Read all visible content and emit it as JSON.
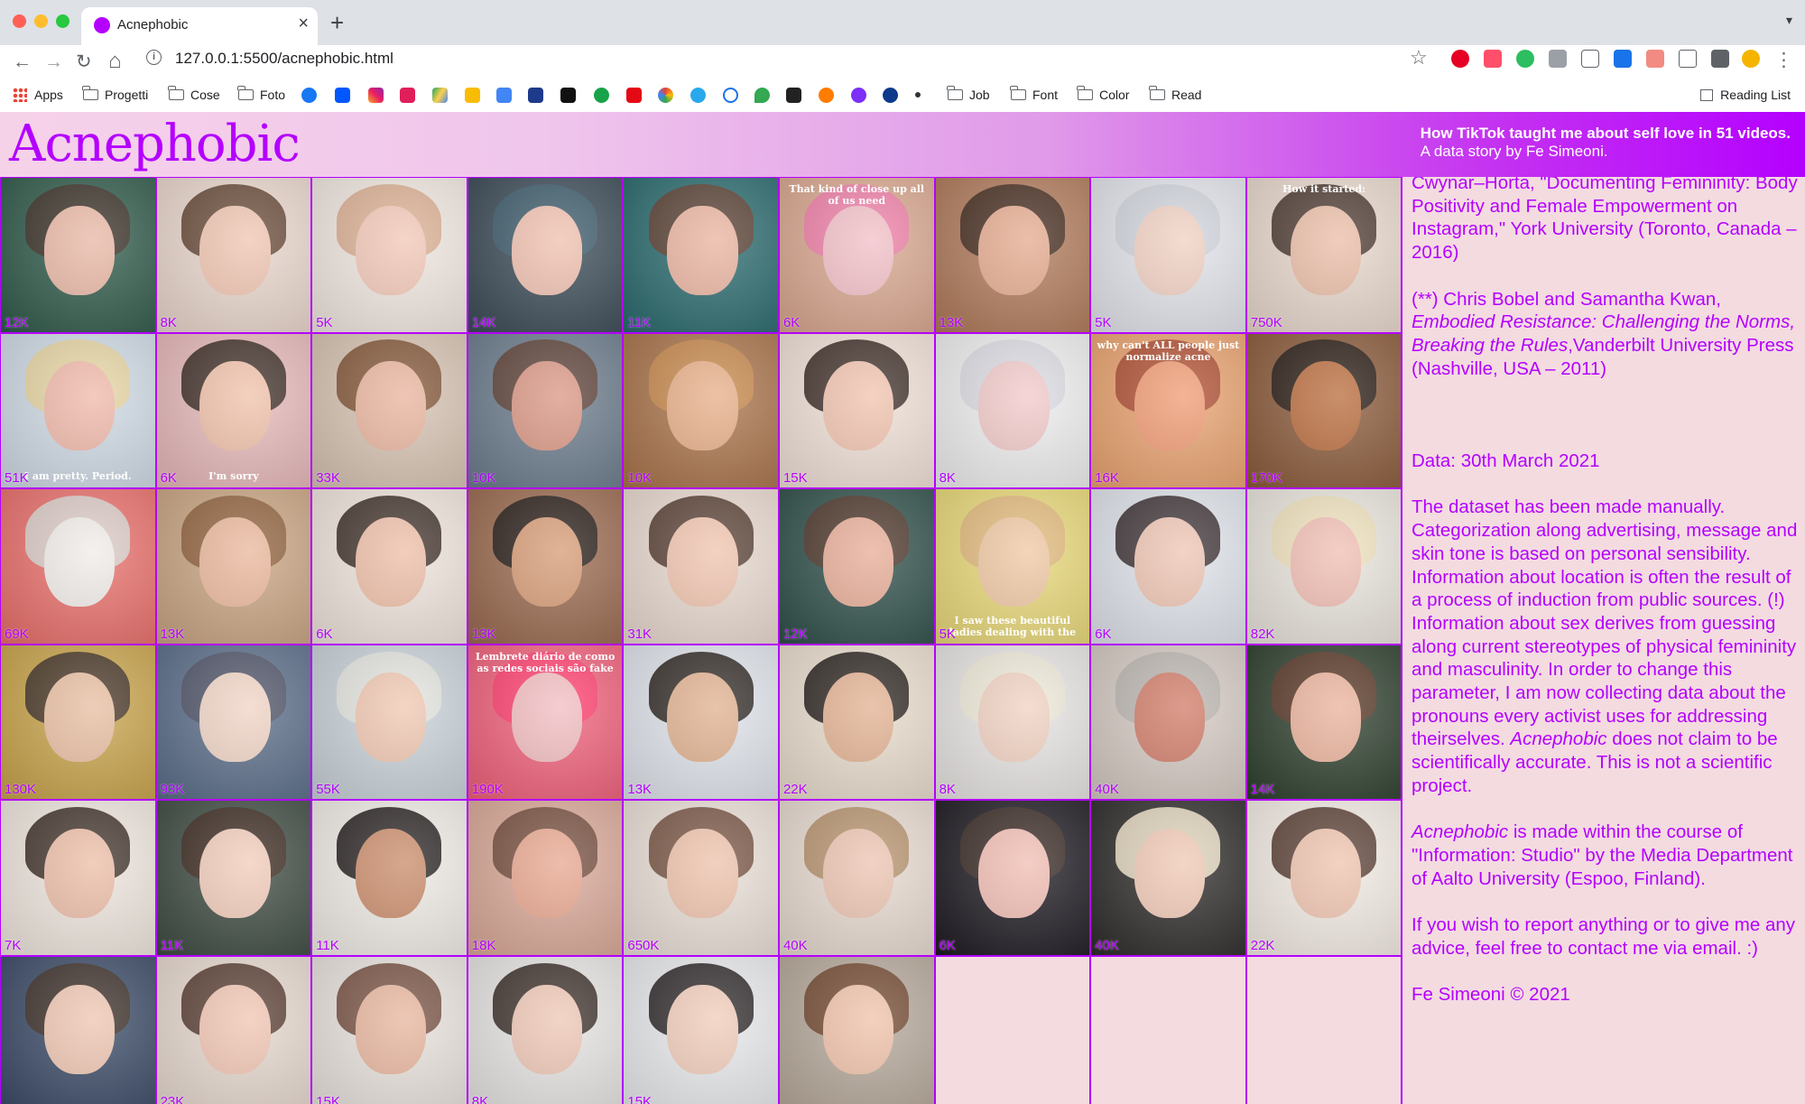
{
  "browser": {
    "tab_title": "Acnephobic",
    "tab_close": "×",
    "new_tab": "+",
    "tab_menu": "▾",
    "url": "127.0.0.1:5500/acnephobic.html",
    "nav_icons": {
      "back": "←",
      "forward": "→",
      "reload": "↻",
      "home": "⌂",
      "star": "☆",
      "menu": "⋮"
    },
    "bookmarks": {
      "apps": "Apps",
      "folders": [
        "Progetti",
        "Cose",
        "Foto",
        "Job",
        "Font",
        "Color",
        "Read"
      ],
      "reading_list": "Reading List"
    },
    "accent_colors": {
      "red": "#fe5f57",
      "yellow": "#febc2e",
      "green": "#28c840"
    }
  },
  "header": {
    "logo": "Acnephobic",
    "tagline_line1": "How TikTok taught me about self love in 51 videos.",
    "tagline_line2": "A data story by Fe Simeoni."
  },
  "theme": {
    "brand": "#b400ff",
    "background": "#f4dbe0"
  },
  "grid": {
    "tiles": [
      {
        "views": "12K",
        "skin": "#e8b6a3",
        "hair": "#3a2a22",
        "bg": "#2f5a4a"
      },
      {
        "views": "8K",
        "skin": "#f0c4b0",
        "hair": "#5a3b28",
        "bg": "#e9d6cc"
      },
      {
        "views": "5K",
        "skin": "#f2c7b6",
        "hair": "#d8a98a",
        "bg": "#f1e7e0"
      },
      {
        "views": "14K",
        "skin": "#efbfae",
        "hair": "#3c5b6b",
        "bg": "#3b4b57"
      },
      {
        "views": "11K",
        "skin": "#e9b29e",
        "hair": "#5b3a2a",
        "bg": "#2a6a6e"
      },
      {
        "views": "6K",
        "skin": "#f2bfc7",
        "hair": "#f07aa9",
        "bg": "#d9a78f",
        "caption": "That kind of close up all of us need",
        "caption_top": true
      },
      {
        "views": "13K",
        "skin": "#e4a98d",
        "hair": "#3b2418",
        "bg": "#b07a5a"
      },
      {
        "views": "5K",
        "skin": "#f1d0c2",
        "hair": "#cfd2da",
        "bg": "#e2e4ea"
      },
      {
        "views": "750K",
        "skin": "#eabca6",
        "hair": "#3d2a22",
        "bg": "#e8d8cc",
        "caption": "How it started:",
        "caption_top": true
      },
      {
        "views": "51K",
        "skin": "#f0b7a8",
        "hair": "#e8d39a",
        "bg": "#cfd9e4",
        "caption": "I am pretty. Period.",
        "caption_top": false
      },
      {
        "views": "6K",
        "skin": "#f0c0a8",
        "hair": "#2f2019",
        "bg": "#e6b8b8",
        "caption": "I'm sorry",
        "caption_top": false
      },
      {
        "views": "33K",
        "skin": "#e9b39c",
        "hair": "#7a4a2a",
        "bg": "#d6c3b2"
      },
      {
        "views": "10K",
        "skin": "#d99582",
        "hair": "#5b3b2f",
        "bg": "#6b7b8b"
      },
      {
        "views": "10K",
        "skin": "#e7ad86",
        "hair": "#c98a4a",
        "bg": "#a9734a"
      },
      {
        "views": "15K",
        "skin": "#f1c2ae",
        "hair": "#2e1e18",
        "bg": "#f0e0d6"
      },
      {
        "views": "8K",
        "skin": "#f2c8c8",
        "hair": "#d8d8e0",
        "bg": "#eeeeee"
      },
      {
        "views": "16K",
        "skin": "#f09a72",
        "hair": "#a8452a",
        "bg": "#e9a26f",
        "caption": "why can't ALL people just normalize acne",
        "caption_top": true
      },
      {
        "views": "170K",
        "skin": "#b86a3a",
        "hair": "#1e1410",
        "bg": "#8a5a3a"
      },
      {
        "views": "69K",
        "skin": "#f0ece8",
        "hair": "#d9d4cf",
        "bg": "#e96f6b"
      },
      {
        "views": "13K",
        "skin": "#eab69a",
        "hair": "#8a5a34",
        "bg": "#c9a482"
      },
      {
        "views": "6K",
        "skin": "#eebda6",
        "hair": "#2f1f18",
        "bg": "#efe4dc"
      },
      {
        "views": "13K",
        "skin": "#d69a74",
        "hair": "#1d1512",
        "bg": "#9a6a4f"
      },
      {
        "views": "31K",
        "skin": "#f0c3ad",
        "hair": "#4a3024",
        "bg": "#e8d9cf"
      },
      {
        "views": "12K",
        "skin": "#e7ab95",
        "hair": "#4f3226",
        "bg": "#2f4f4a"
      },
      {
        "views": "5K",
        "skin": "#f0c7a2",
        "hair": "#e0b67a",
        "bg": "#e8d878",
        "caption": "I saw these beautiful ladies dealing with the",
        "caption_top": false
      },
      {
        "views": "6K",
        "skin": "#eec4b2",
        "hair": "#2e2024",
        "bg": "#dfe3ea"
      },
      {
        "views": "82K",
        "skin": "#f0bdb2",
        "hair": "#efe0b8",
        "bg": "#e9e4dc"
      },
      {
        "views": "130K",
        "skin": "#e8bda0",
        "hair": "#3a2a20",
        "bg": "#c8a34a"
      },
      {
        "views": "93K",
        "skin": "#f0d3c4",
        "hair": "#4b4f63",
        "bg": "#5a6d88"
      },
      {
        "views": "55K",
        "skin": "#f0c6b0",
        "hair": "#e6e6e0",
        "bg": "#c9d2d8"
      },
      {
        "views": "190K",
        "skin": "#f2bcc0",
        "hair": "#ff3b6b",
        "bg": "#f0607a",
        "caption": "Lembrete diário de como as redes sociais são fake",
        "caption_top": true
      },
      {
        "views": "13K",
        "skin": "#e0b08e",
        "hair": "#1f1612",
        "bg": "#dfe3ea"
      },
      {
        "views": "22K",
        "skin": "#e2b090",
        "hair": "#1a1210",
        "bg": "#e8dccc"
      },
      {
        "views": "8K",
        "skin": "#f1d1c1",
        "hair": "#eeead8",
        "bg": "#e7e4e2"
      },
      {
        "views": "40K",
        "skin": "#d07a66",
        "hair": "#b8b2ae",
        "bg": "#d4c9c2"
      },
      {
        "views": "14K",
        "skin": "#eab19a",
        "hair": "#5a3424",
        "bg": "#2e3f2e"
      },
      {
        "views": "7K",
        "skin": "#ecbca6",
        "hair": "#2f2018",
        "bg": "#efe6de"
      },
      {
        "views": "11K",
        "skin": "#f1cbb9",
        "hair": "#3a261c",
        "bg": "#3e4b42"
      },
      {
        "views": "11K",
        "skin": "#c98a68",
        "hair": "#15100e",
        "bg": "#f0ece6"
      },
      {
        "views": "18K",
        "skin": "#e8a68e",
        "hair": "#6a4434",
        "bg": "#d9a897"
      },
      {
        "views": "650K",
        "skin": "#eec1aa",
        "hair": "#6b4634",
        "bg": "#e9dfd6"
      },
      {
        "views": "40K",
        "skin": "#ecc3b0",
        "hair": "#b08a62",
        "bg": "#e7dad0"
      },
      {
        "views": "6K",
        "skin": "#f0bcb2",
        "hair": "#3a2a24",
        "bg": "#1e1a22"
      },
      {
        "views": "40K",
        "skin": "#f0c8b4",
        "hair": "#efe2c8",
        "bg": "#2e2c2a"
      },
      {
        "views": "22K",
        "skin": "#efc3ae",
        "hair": "#4b2f24",
        "bg": "#f3ebe4"
      },
      {
        "views": "",
        "skin": "#eec4b0",
        "hair": "#3b2a20",
        "bg": "#3a4a66"
      },
      {
        "views": "23K",
        "skin": "#f0c4b2",
        "hair": "#4a2f24",
        "bg": "#e6d8ce"
      },
      {
        "views": "15K",
        "skin": "#e7b49c",
        "hair": "#6b4332",
        "bg": "#e8e2dc"
      },
      {
        "views": "8K",
        "skin": "#eec6b4",
        "hair": "#2a1d18",
        "bg": "#e6e4e2"
      },
      {
        "views": "15K",
        "skin": "#f0cbb8",
        "hair": "#1b1516",
        "bg": "#e8e9ec"
      },
      {
        "views": "",
        "skin": "#efc1a8",
        "hair": "#6a3e26",
        "bg": "#b6a89a"
      }
    ]
  },
  "sidebar": {
    "ref1": "Cwynar–Horta, \"Documenting Femininity: Body Positivity and Female Empowerment on Instagram,\" York University (Toronto, Canada – 2016)",
    "ref2_prefix": "(**) Chris Bobel and Samantha Kwan, ",
    "ref2_title": "Embodied Resistance: Challenging the Norms, Breaking the Rules",
    "ref2_suffix": ",Vanderbilt University Press (Nashville, USA – 2011)",
    "data_date": "Data: 30th March 2021",
    "dataset_a": "The dataset has been made manually. Categorization along advertising, message and skin tone is based on personal sensibility. Information about location is often the result of a process of induction from public sources. (!) Information about sex derives from guessing along current stereotypes of physical femininity and masculinity. In order to change this parameter, I am now collecting data about the pronouns every activist uses for addressing theirselves. ",
    "dataset_italic": "Acnephobic",
    "dataset_b": " does not claim to be scientifically accurate. This is not a scientific project.",
    "course_italic": "Acnephobic",
    "course_text": " is made within the course of \"Information: Studio\" by the Media Department of Aalto University (Espoo, Finland).",
    "contact_prefix": "If you wish to report anything or to give me any advice, feel free to contact me via ",
    "contact_link": "email.",
    "contact_suffix": " :)",
    "copyright": "Fe Simeoni © 2021"
  }
}
